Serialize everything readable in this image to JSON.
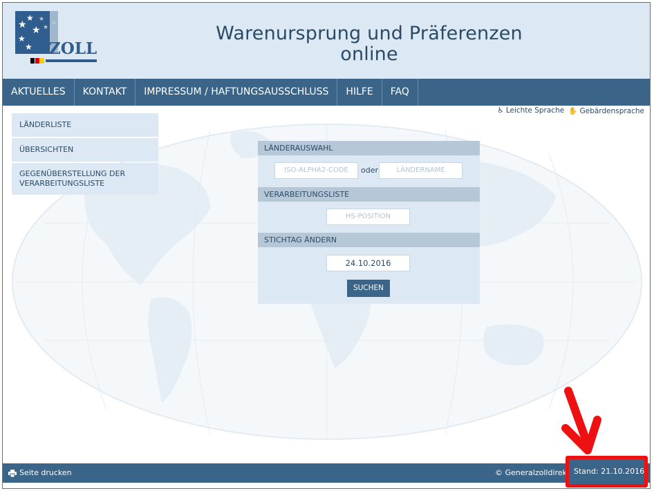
{
  "header": {
    "logo_text": "ZOLL",
    "title_line1": "Warenursprung und Präferenzen",
    "title_line2": "online"
  },
  "nav": {
    "items": [
      "AKTUELLES",
      "KONTAKT",
      "IMPRESSUM / HAFTUNGSAUSSCHLUSS",
      "HILFE",
      "FAQ"
    ]
  },
  "accessibility": {
    "easy_language": "Leichte Sprache",
    "sign_language": "Gebärdensprache"
  },
  "sidebar": {
    "items": [
      {
        "label": "LÄNDERLISTE"
      },
      {
        "label": "ÜBERSICHTEN"
      },
      {
        "label_line1": "GEGENÜBERSTELLUNG DER",
        "label_line2": "VERARBEITUNGSLISTE"
      }
    ]
  },
  "search": {
    "country_header": "LÄNDERAUSWAHL",
    "iso_placeholder": "ISO-ALPHA2-CODE",
    "or_label": "oder",
    "country_placeholder": "LÄNDERNAME",
    "list_header": "VERARBEITUNGSLISTE",
    "hs_placeholder": "HS-POSITION",
    "date_header": "STICHTAG ÄNDERN",
    "date_value": "24.10.2016",
    "search_label": "SUCHEN"
  },
  "footer": {
    "print_label": "Seite drucken",
    "copyright": "© Generalzolldirektio",
    "stand": "Stand: 21.10.2016"
  },
  "colors": {
    "header_bg": "#dce8f3",
    "nav_bg": "#3a6488",
    "panel_head": "#b6c8d8",
    "annotation_red": "#ee1111"
  },
  "icons": [
    "zoll-logo",
    "easy-language-icon",
    "sign-language-icon",
    "printer-icon",
    "red-arrow-annotation"
  ]
}
